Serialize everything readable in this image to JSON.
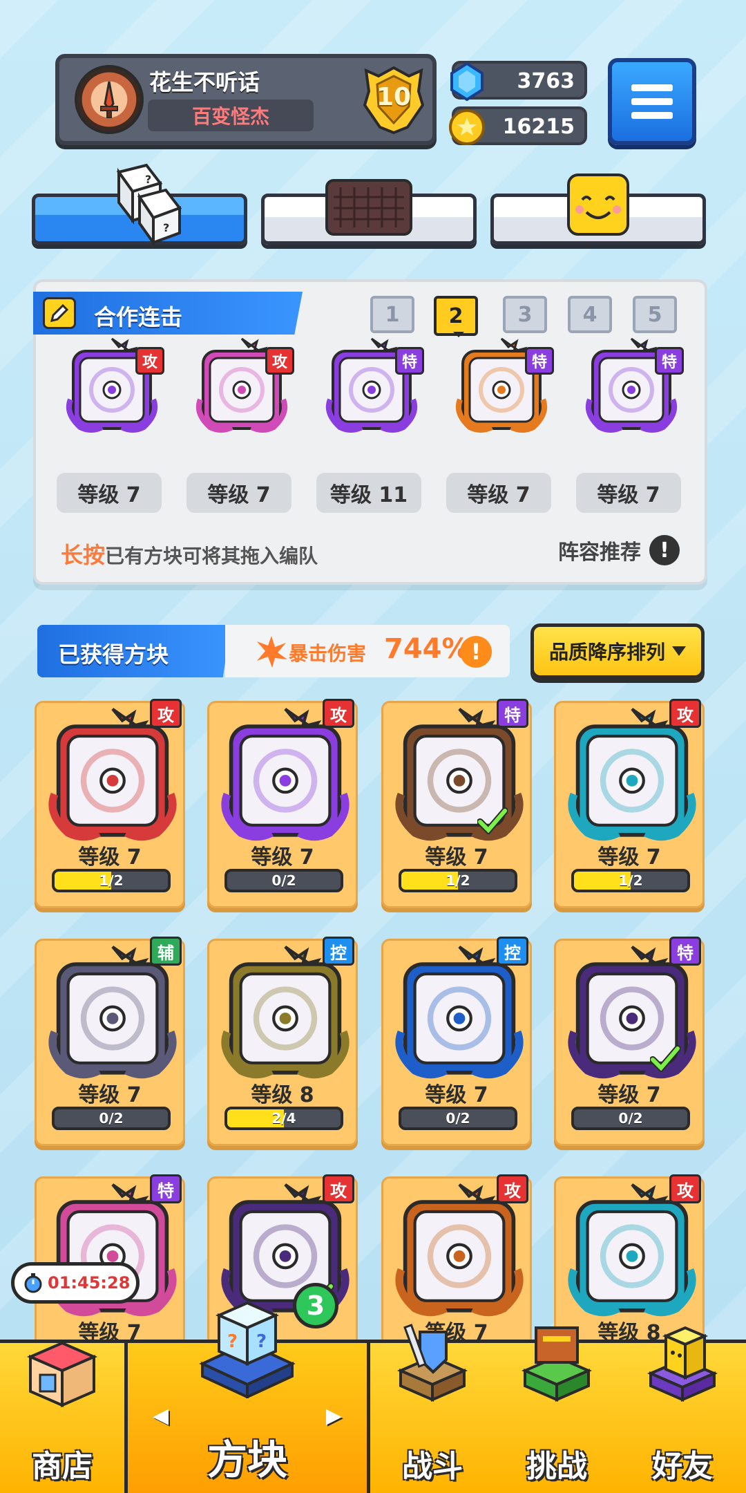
{
  "player": {
    "name": "花生不听话",
    "title": "百变怪杰",
    "rank": "10"
  },
  "currency": {
    "gems": "3763",
    "coins": "16215"
  },
  "combo": {
    "header": "合作连击",
    "deck_tabs": [
      "1",
      "2",
      "3",
      "4",
      "5"
    ],
    "selected_deck": "2",
    "slots": [
      {
        "tag": "攻",
        "tag_type": "atk",
        "level": "等级 7",
        "color": "#8a3ee0",
        "art": "Combo-rune"
      },
      {
        "tag": "攻",
        "tag_type": "atk",
        "level": "等级 7",
        "color": "#d14bb8",
        "art_text": "Combo"
      },
      {
        "tag": "特",
        "tag_type": "spe",
        "level": "等级 11",
        "color": "#8a3ee0",
        "art": "crack"
      },
      {
        "tag": "特",
        "tag_type": "spe",
        "level": "等级 7",
        "color": "#e67a1e",
        "art": "infinity"
      },
      {
        "tag": "特",
        "tag_type": "spe",
        "level": "等级 7",
        "color": "#8a3ee0",
        "art": "cycle"
      }
    ],
    "hint_highlight": "长按",
    "hint_text": "已有方块可将其拖入编队",
    "recommend": "阵容推荐",
    "recommend_icon": "!"
  },
  "obtained": {
    "label": "已获得方块",
    "crit_label": "暴击伤害",
    "crit_value": "744%",
    "info_icon": "!",
    "sort_label": "品质降序排列"
  },
  "cards": [
    {
      "tag": "攻",
      "tag_type": "atk",
      "level": "等级 7",
      "progress": "1/2",
      "fill": 0.5,
      "color": "#d63a3a",
      "check": false
    },
    {
      "tag": "攻",
      "tag_type": "atk",
      "level": "等级 7",
      "progress": "0/2",
      "fill": 0,
      "color": "#8a3ee0",
      "check": false
    },
    {
      "tag": "特",
      "tag_type": "spe",
      "level": "等级 7",
      "progress": "1/2",
      "fill": 0.5,
      "color": "#7a4a2a",
      "check": true
    },
    {
      "tag": "攻",
      "tag_type": "atk",
      "level": "等级 7",
      "progress": "1/2",
      "fill": 0.5,
      "color": "#1ea8c0",
      "check": false
    },
    {
      "tag": "辅",
      "tag_type": "sup",
      "level": "等级 7",
      "progress": "0/2",
      "fill": 0,
      "color": "#5a5a78",
      "check": false
    },
    {
      "tag": "控",
      "tag_type": "ctl",
      "level": "等级 8",
      "progress": "2/4",
      "fill": 0.5,
      "color": "#8a7a2a",
      "check": false
    },
    {
      "tag": "控",
      "tag_type": "ctl",
      "level": "等级 7",
      "progress": "0/2",
      "fill": 0,
      "color": "#1e5ec8",
      "check": false
    },
    {
      "tag": "特",
      "tag_type": "spe",
      "level": "等级 7",
      "progress": "0/2",
      "fill": 0,
      "color": "#4a2a7a",
      "check": true
    },
    {
      "tag": "特",
      "tag_type": "spe",
      "level": "等级 7",
      "progress": "",
      "fill": 0,
      "color": "#d14b9a",
      "check": false
    },
    {
      "tag": "攻",
      "tag_type": "atk",
      "level": "",
      "progress": "",
      "fill": 0,
      "color": "#4a2a7a",
      "check": true
    },
    {
      "tag": "攻",
      "tag_type": "atk",
      "level": "等级 7",
      "progress": "",
      "fill": 0,
      "color": "#c8641e",
      "check": false
    },
    {
      "tag": "攻",
      "tag_type": "atk",
      "level": "等级 8",
      "progress": "",
      "fill": 0,
      "color": "#1ea8c0",
      "check": false
    }
  ],
  "timer": "01:45:28",
  "nav": {
    "shop": "商店",
    "blocks": "方块",
    "battle": "战斗",
    "challenge": "挑战",
    "friends": "好友",
    "blocks_badge": "3",
    "prev_arrow": "◀",
    "next_arrow": "▶"
  },
  "colors": {
    "accent_blue": "#2a86f0",
    "accent_yellow": "#ffc414",
    "card_bg": "#ffc86a"
  }
}
